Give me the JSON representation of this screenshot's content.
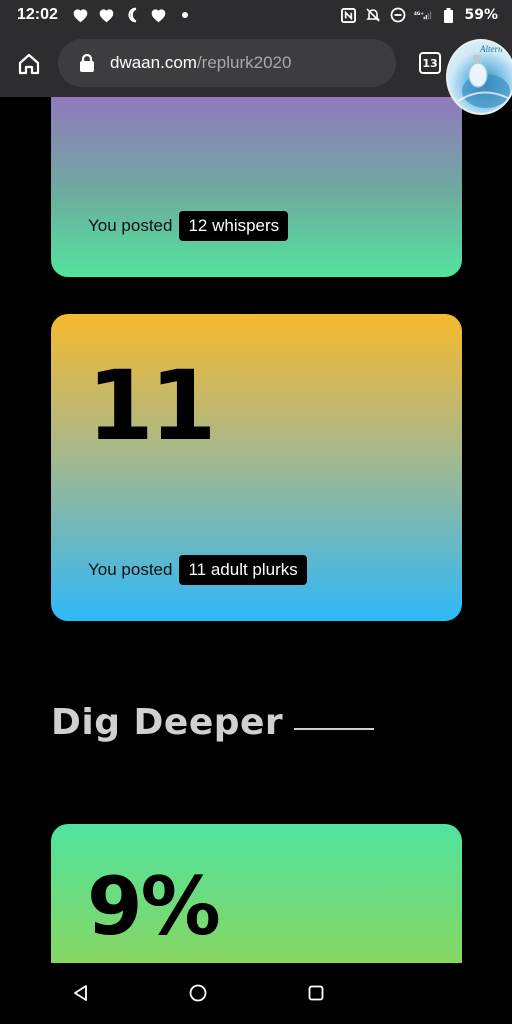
{
  "status": {
    "time": "12:02",
    "battery": "59%",
    "left_icons": [
      "heart-icon",
      "heart-icon",
      "moon-icon",
      "heart-icon",
      "dot-icon"
    ],
    "right_icons": [
      "nfc-icon",
      "bell-off-icon",
      "dnd-icon",
      "signal-icon",
      "battery-icon"
    ]
  },
  "browser": {
    "url_host": "dwaan.com",
    "url_path": "/replurk2020",
    "tab_count": "13",
    "avatar_text": "Altern"
  },
  "cards": {
    "whispers": {
      "prefix": "You posted",
      "pill": "12 whispers"
    },
    "adult": {
      "number": "11",
      "prefix": "You posted",
      "pill": "11 adult plurks"
    },
    "deeper": {
      "number": "9%"
    }
  },
  "section": {
    "title": "Dig Deeper"
  },
  "colors": {
    "card1_top": "#9b6fc4",
    "card1_bottom": "#53e39d",
    "card2_top": "#f7b92e",
    "card2_bottom": "#30b8f7",
    "card3_top": "#4fe39e",
    "card3_bottom": "#8fd45a"
  }
}
